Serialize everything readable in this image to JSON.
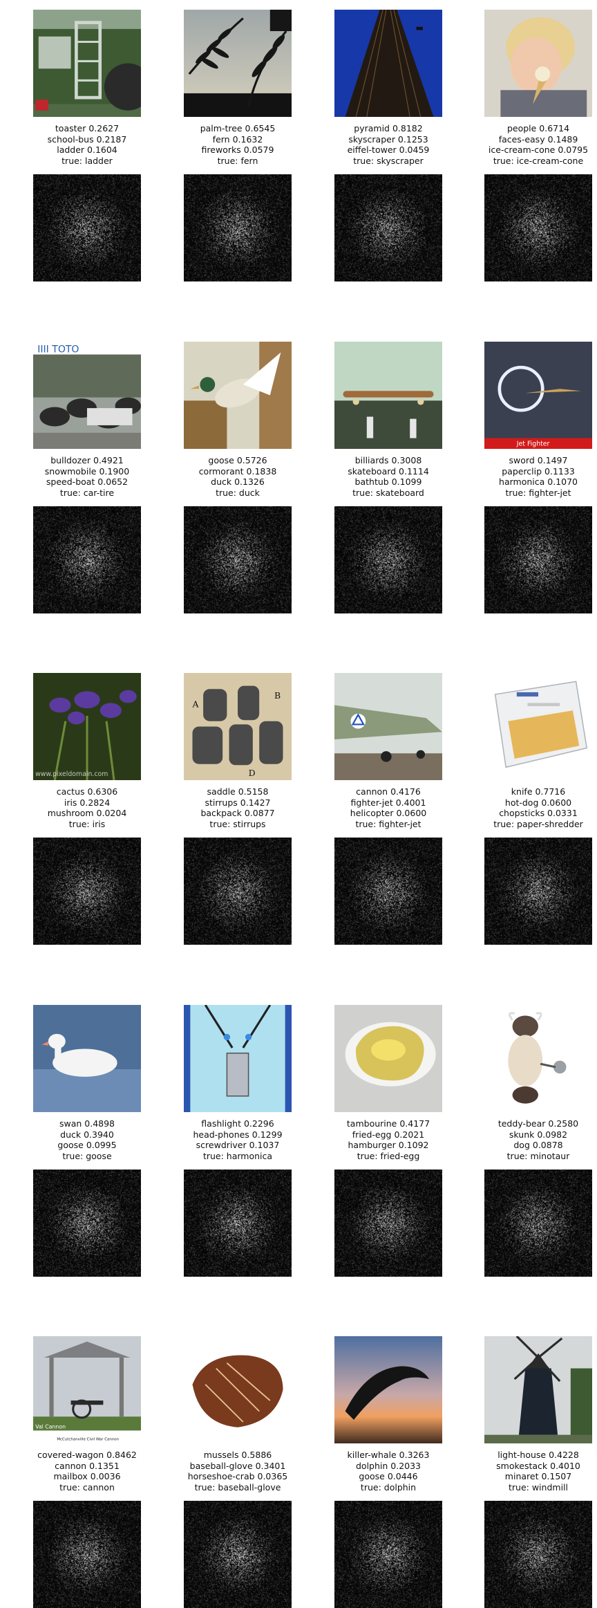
{
  "cells": [
    {
      "preds": [
        "toaster 0.2627",
        "school-bus 0.2187",
        "ladder 0.1604"
      ],
      "true": "true: ladder",
      "img": "car-ladder-photo",
      "sal": "ladder-saliency-map"
    },
    {
      "preds": [
        "palm-tree 0.6545",
        "fern 0.1632",
        "fireworks 0.0579"
      ],
      "true": "true: fern",
      "img": "fern-silhouette-photo",
      "sal": "fern-saliency-map"
    },
    {
      "preds": [
        "pyramid 0.8182",
        "skyscraper 0.1253",
        "eiffel-tower 0.0459"
      ],
      "true": "true: skyscraper",
      "img": "skyscraper-photo",
      "sal": "skyscraper-saliency-map"
    },
    {
      "preds": [
        "people 0.6714",
        "faces-easy 0.1489",
        "ice-cream-cone 0.0795"
      ],
      "true": "true: ice-cream-cone",
      "img": "child-ice-cream-photo",
      "sal": "ice-cream-saliency-map"
    },
    {
      "preds": [
        "bulldozer 0.4921",
        "snowmobile 0.1900",
        "speed-boat 0.0652"
      ],
      "true": "true: car-tire",
      "img": "tire-pile-photo",
      "sal": "car-tire-saliency-map"
    },
    {
      "preds": [
        "goose 0.5726",
        "cormorant 0.1838",
        "duck 0.1326"
      ],
      "true": "true: duck",
      "img": "duck-painting",
      "sal": "duck-saliency-map"
    },
    {
      "preds": [
        "billiards 0.3008",
        "skateboard 0.1114",
        "bathtub 0.1099"
      ],
      "true": "true: skateboard",
      "img": "skateboard-photo",
      "sal": "skateboard-saliency-map"
    },
    {
      "preds": [
        "sword 0.1497",
        "paperclip 0.1133",
        "harmonica 0.1070"
      ],
      "true": "true: fighter-jet",
      "img": "fighter-jet-poster",
      "sal": "fighter-jet-saliency-map"
    },
    {
      "preds": [
        "cactus 0.6306",
        "iris 0.2824",
        "mushroom 0.0204"
      ],
      "true": "true: iris",
      "img": "iris-flowers-photo",
      "sal": "iris-saliency-map"
    },
    {
      "preds": [
        "saddle 0.5158",
        "stirrups 0.1427",
        "backpack 0.0877"
      ],
      "true": "true: stirrups",
      "img": "stirrups-illustration",
      "sal": "stirrups-saliency-map"
    },
    {
      "preds": [
        "cannon 0.4176",
        "fighter-jet 0.4001",
        "helicopter 0.0600"
      ],
      "true": "true: fighter-jet",
      "img": "parked-jet-photo",
      "sal": "parked-jet-saliency-map"
    },
    {
      "preds": [
        "knife 0.7716",
        "hot-dog 0.0600",
        "chopsticks 0.0331"
      ],
      "true": "true: paper-shredder",
      "img": "paper-shredder-photo",
      "sal": "shredder-saliency-map"
    },
    {
      "preds": [
        "swan 0.4898",
        "duck 0.3940",
        "goose 0.0995"
      ],
      "true": "true: goose",
      "img": "white-goose-photo",
      "sal": "goose-saliency-map"
    },
    {
      "preds": [
        "flashlight 0.2296",
        "head-phones 0.1299",
        "screwdriver 0.1037"
      ],
      "true": "true: harmonica",
      "img": "harmonica-pendant-photo",
      "sal": "harmonica-saliency-map"
    },
    {
      "preds": [
        "tambourine 0.4177",
        "fried-egg 0.2021",
        "hamburger 0.1092"
      ],
      "true": "true: fried-egg",
      "img": "fried-egg-photo",
      "sal": "fried-egg-saliency-map"
    },
    {
      "preds": [
        "teddy-bear 0.2580",
        "skunk 0.0982",
        "dog 0.0878"
      ],
      "true": "true: minotaur",
      "img": "minotaur-figure-photo",
      "sal": "minotaur-saliency-map"
    },
    {
      "preds": [
        "covered-wagon 0.8462",
        "cannon 0.1351",
        "mailbox 0.0036"
      ],
      "true": "true: cannon",
      "img": "cannon-pavilion-photo",
      "sal": "cannon-saliency-map"
    },
    {
      "preds": [
        "mussels 0.5886",
        "baseball-glove 0.3401",
        "horseshoe-crab 0.0365"
      ],
      "true": "true: baseball-glove",
      "img": "baseball-glove-photo",
      "sal": "glove-saliency-map"
    },
    {
      "preds": [
        "killer-whale 0.3263",
        "dolphin 0.2033",
        "goose 0.0446"
      ],
      "true": "true: dolphin",
      "img": "dolphin-sunset-photo",
      "sal": "dolphin-saliency-map"
    },
    {
      "preds": [
        "light-house 0.4228",
        "smokestack 0.4010",
        "minaret 0.1507"
      ],
      "true": "true: windmill",
      "img": "windmill-photo",
      "sal": "windmill-saliency-map"
    }
  ],
  "logo_text": {
    "poster": "Jet Fighter",
    "watermark": "www.pixeldomain.com",
    "sign": "Val Cannon",
    "plaque": "McCutchanville Civil War Cannon"
  }
}
